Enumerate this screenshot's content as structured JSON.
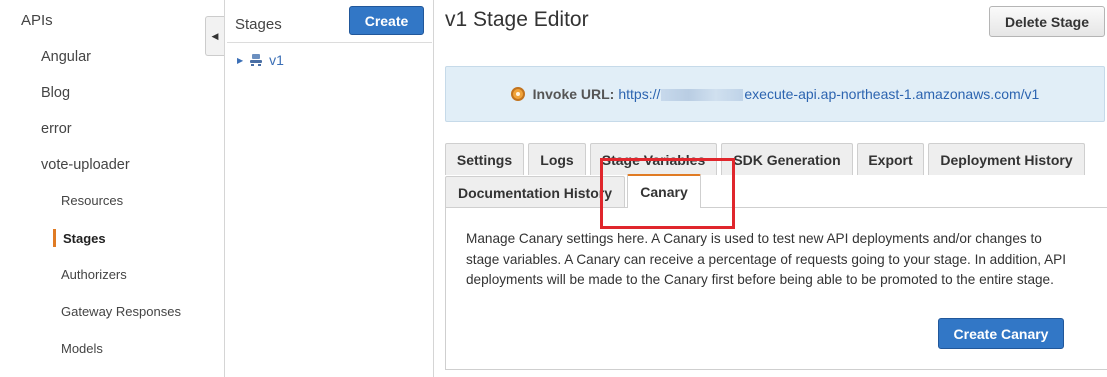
{
  "nav": {
    "root": "APIs",
    "apis": [
      "Angular",
      "Blog",
      "error",
      "vote-uploader"
    ],
    "sub_items": [
      "Resources",
      "Stages",
      "Authorizers",
      "Gateway Responses",
      "Models"
    ]
  },
  "stages": {
    "title": "Stages",
    "create_label": "Create",
    "tree": [
      {
        "name": "v1"
      }
    ]
  },
  "editor": {
    "title": "v1 Stage Editor",
    "delete_label": "Delete Stage",
    "invoke_label": "Invoke URL:",
    "invoke_url_prefix": "https://",
    "invoke_url_suffix": "execute-api.ap-northeast-1.amazonaws.com/v1",
    "tabs": [
      "Settings",
      "Logs",
      "Stage Variables",
      "SDK Generation",
      "Export",
      "Deployment History",
      "Documentation History",
      "Canary"
    ],
    "active_tab": "Canary",
    "canary_description": "Manage Canary settings here. A Canary is used to test new API deployments and/or changes to stage variables. A Canary can receive a percentage of requests going to your stage. In addition, API deployments will be made to the Canary first before being able to be promoted to the entire stage.",
    "create_canary_label": "Create Canary"
  },
  "colors": {
    "accent": "#e07b24",
    "primary_button": "#3277c6",
    "highlight": "#e0262c"
  }
}
